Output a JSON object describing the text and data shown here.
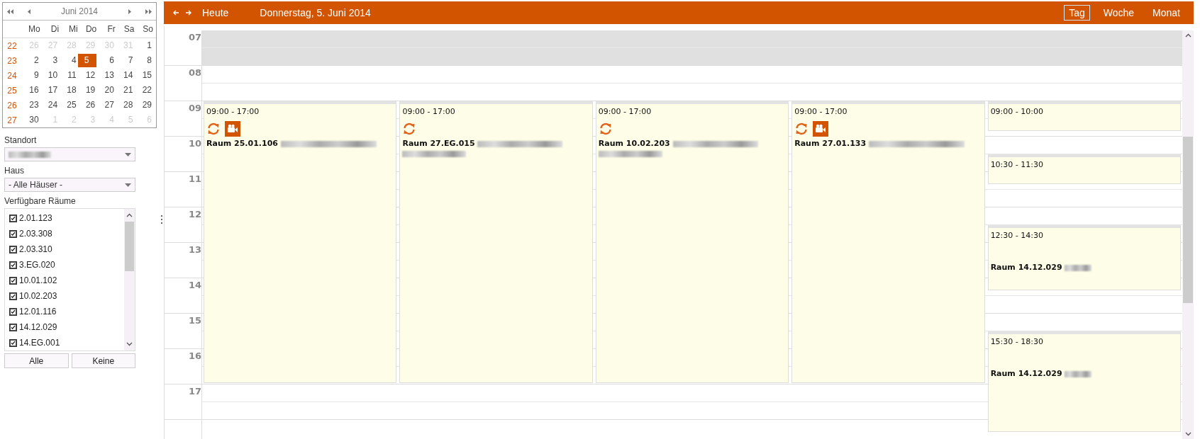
{
  "mini_calendar": {
    "month": "Juni 2014",
    "weekdays": [
      "Mo",
      "Di",
      "Mi",
      "Do",
      "Fr",
      "Sa",
      "So"
    ],
    "weeks": [
      {
        "number": "22",
        "days": [
          {
            "label": "26",
            "outside": true,
            "selected": false
          },
          {
            "label": "27",
            "outside": true,
            "selected": false
          },
          {
            "label": "28",
            "outside": true,
            "selected": false
          },
          {
            "label": "29",
            "outside": true,
            "selected": false
          },
          {
            "label": "30",
            "outside": true,
            "selected": false
          },
          {
            "label": "31",
            "outside": true,
            "selected": false
          },
          {
            "label": "1",
            "outside": false,
            "selected": false
          }
        ]
      },
      {
        "number": "23",
        "days": [
          {
            "label": "2",
            "outside": false,
            "selected": false
          },
          {
            "label": "3",
            "outside": false,
            "selected": false
          },
          {
            "label": "4",
            "outside": false,
            "selected": false
          },
          {
            "label": "5",
            "outside": false,
            "selected": true
          },
          {
            "label": "6",
            "outside": false,
            "selected": false
          },
          {
            "label": "7",
            "outside": false,
            "selected": false
          },
          {
            "label": "8",
            "outside": false,
            "selected": false
          }
        ]
      },
      {
        "number": "24",
        "days": [
          {
            "label": "9",
            "outside": false,
            "selected": false
          },
          {
            "label": "10",
            "outside": false,
            "selected": false
          },
          {
            "label": "11",
            "outside": false,
            "selected": false
          },
          {
            "label": "12",
            "outside": false,
            "selected": false
          },
          {
            "label": "13",
            "outside": false,
            "selected": false
          },
          {
            "label": "14",
            "outside": false,
            "selected": false
          },
          {
            "label": "15",
            "outside": false,
            "selected": false
          }
        ]
      },
      {
        "number": "25",
        "days": [
          {
            "label": "16",
            "outside": false,
            "selected": false
          },
          {
            "label": "17",
            "outside": false,
            "selected": false
          },
          {
            "label": "18",
            "outside": false,
            "selected": false
          },
          {
            "label": "19",
            "outside": false,
            "selected": false
          },
          {
            "label": "20",
            "outside": false,
            "selected": false
          },
          {
            "label": "21",
            "outside": false,
            "selected": false
          },
          {
            "label": "22",
            "outside": false,
            "selected": false
          }
        ]
      },
      {
        "number": "26",
        "days": [
          {
            "label": "23",
            "outside": false,
            "selected": false
          },
          {
            "label": "24",
            "outside": false,
            "selected": false
          },
          {
            "label": "25",
            "outside": false,
            "selected": false
          },
          {
            "label": "26",
            "outside": false,
            "selected": false
          },
          {
            "label": "27",
            "outside": false,
            "selected": false
          },
          {
            "label": "28",
            "outside": false,
            "selected": false
          },
          {
            "label": "29",
            "outside": false,
            "selected": false
          }
        ]
      },
      {
        "number": "27",
        "days": [
          {
            "label": "30",
            "outside": false,
            "selected": false
          },
          {
            "label": "1",
            "outside": true,
            "selected": false
          },
          {
            "label": "2",
            "outside": true,
            "selected": false
          },
          {
            "label": "3",
            "outside": true,
            "selected": false
          },
          {
            "label": "4",
            "outside": true,
            "selected": false
          },
          {
            "label": "5",
            "outside": true,
            "selected": false
          },
          {
            "label": "6",
            "outside": true,
            "selected": false
          }
        ]
      }
    ]
  },
  "filters": {
    "location": {
      "label": "Standort",
      "redacted": true
    },
    "building": {
      "label": "Haus",
      "value": "- Alle Häuser -"
    }
  },
  "rooms": {
    "label": "Verfügbare Räume",
    "items": [
      {
        "label": "2.01.123",
        "checked": true
      },
      {
        "label": "2.03.308",
        "checked": true
      },
      {
        "label": "2.03.310",
        "checked": true
      },
      {
        "label": "3.EG.020",
        "checked": true
      },
      {
        "label": "10.01.102",
        "checked": true
      },
      {
        "label": "10.02.203",
        "checked": true
      },
      {
        "label": "12.01.116",
        "checked": true
      },
      {
        "label": "14.12.029",
        "checked": true
      },
      {
        "label": "14.EG.001",
        "checked": true
      }
    ],
    "buttons": [
      "Alle",
      "Keine"
    ]
  },
  "toolbar": {
    "today": "Heute",
    "title": "Donnerstag, 5. Juni 2014",
    "views": [
      {
        "label": "Tag",
        "selected": true
      },
      {
        "label": "Woche",
        "selected": false
      },
      {
        "label": "Monat",
        "selected": false
      }
    ]
  },
  "hours": [
    {
      "label": "07",
      "shaded": true
    },
    {
      "label": "08",
      "shaded": false
    },
    {
      "label": "09",
      "shaded": false
    },
    {
      "label": "10",
      "shaded": false
    },
    {
      "label": "11",
      "shaded": false
    },
    {
      "label": "12",
      "shaded": false
    },
    {
      "label": "13",
      "shaded": false
    },
    {
      "label": "14",
      "shaded": false
    },
    {
      "label": "15",
      "shaded": false
    },
    {
      "label": "16",
      "shaded": false
    },
    {
      "label": "17",
      "shaded": false
    }
  ],
  "columns": [
    {
      "events": [
        {
          "time": "09:00 - 17:00",
          "room": "Raum 25.01.106",
          "recurring": true,
          "video": true,
          "kind": "long"
        }
      ]
    },
    {
      "events": [
        {
          "time": "09:00 - 17:00",
          "room": "Raum 27.EG.015",
          "recurring": true,
          "video": false,
          "kind": "wrapped"
        }
      ]
    },
    {
      "events": [
        {
          "time": "09:00 - 17:00",
          "room": "Raum 10.02.203",
          "recurring": true,
          "video": false,
          "kind": "wrapped"
        }
      ]
    },
    {
      "events": [
        {
          "time": "09:00 - 17:00",
          "room": "Raum 27.01.133",
          "recurring": true,
          "video": true,
          "kind": "long"
        }
      ]
    },
    {
      "events": [
        {
          "time": "09:00 - 10:00",
          "recurring": false,
          "video": false
        },
        {
          "time": "10:30 - 11:30",
          "recurring": false,
          "video": false
        },
        {
          "time": "12:30 - 14:30",
          "room": "Raum 14.12.029",
          "recurring": false,
          "video": false,
          "kind": "short"
        },
        {
          "time": "15:30 - 18:30",
          "room": "Raum 14.12.029",
          "recurring": false,
          "video": false,
          "kind": "short"
        }
      ]
    }
  ]
}
